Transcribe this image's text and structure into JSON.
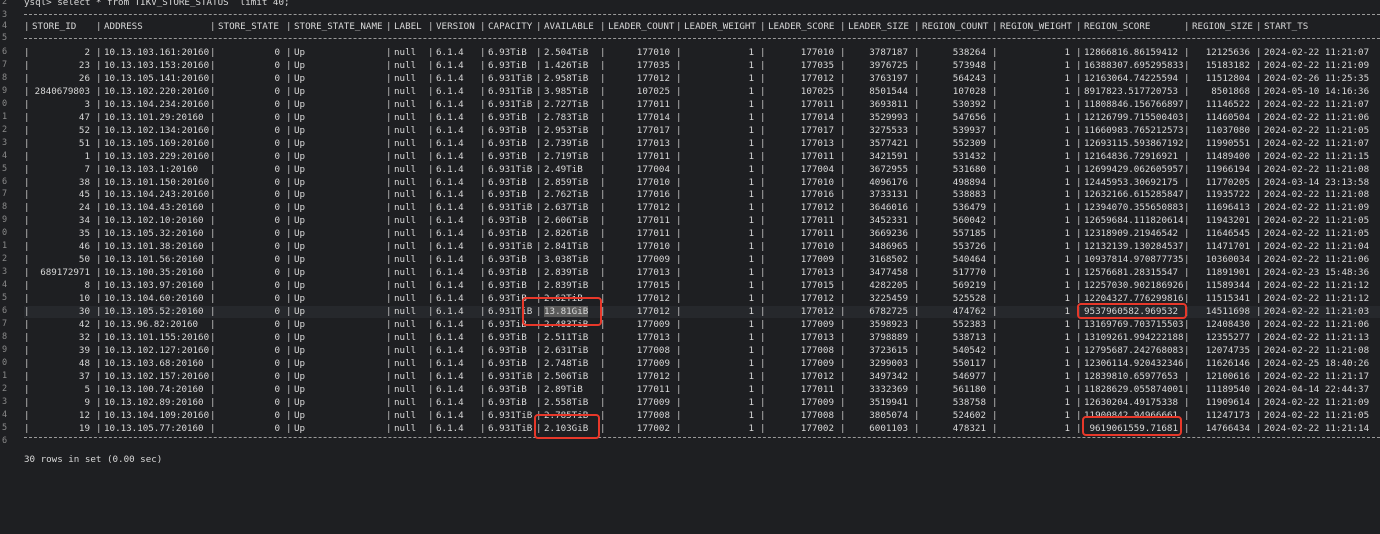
{
  "command": "ysql> select * from TIKV_STORE_STATUS  limit 40;",
  "footer": "30 rows in set (0.00 sec)",
  "gutter": [
    "2",
    "3",
    "4",
    "5",
    "6",
    "7",
    "8",
    "9",
    "0",
    "1",
    "2",
    "3",
    "4",
    "5",
    "6",
    "7",
    "8",
    "9",
    "0",
    "1",
    "2",
    "3",
    "4",
    "5",
    "6",
    "7",
    "8",
    "9",
    "0",
    "1",
    "2",
    "3",
    "4",
    "5",
    "6"
  ],
  "columns": [
    "STORE_ID",
    "ADDRESS",
    "STORE_STATE",
    "STORE_STATE_NAME",
    "LABEL",
    "VERSION",
    "CAPACITY",
    "AVAILABLE",
    "LEADER_COUNT",
    "LEADER_WEIGHT",
    "LEADER_SCORE",
    "LEADER_SIZE",
    "REGION_COUNT",
    "REGION_WEIGHT",
    "REGION_SCORE",
    "REGION_SIZE",
    "START_TS"
  ],
  "rows": [
    [
      "2",
      "10.13.103.161:20160",
      "0",
      "Up",
      "null",
      "6.1.4",
      "6.93TiB",
      "2.504TiB",
      "177010",
      "1",
      "177010",
      "3787187",
      "538264",
      "1",
      "12866816.86159412",
      "12125636",
      "2024-02-22 11:21:07"
    ],
    [
      "23",
      "10.13.103.153:20160",
      "0",
      "Up",
      "null",
      "6.1.4",
      "6.93TiB",
      "1.426TiB",
      "177035",
      "1",
      "177035",
      "3976725",
      "573948",
      "1",
      "16388307.695295833",
      "15183182",
      "2024-02-22 11:21:09"
    ],
    [
      "26",
      "10.13.105.141:20160",
      "0",
      "Up",
      "null",
      "6.1.4",
      "6.931TiB",
      "2.958TiB",
      "177012",
      "1",
      "177012",
      "3763197",
      "564243",
      "1",
      "12163064.74225594",
      "11512804",
      "2024-02-26 11:25:35"
    ],
    [
      "2840679803",
      "10.13.102.220:20160",
      "0",
      "Up",
      "null",
      "6.1.4",
      "6.931TiB",
      "3.985TiB",
      "107025",
      "1",
      "107025",
      "8501544",
      "107028",
      "1",
      "8917823.517720753",
      "8501868",
      "2024-05-10 14:16:36"
    ],
    [
      "3",
      "10.13.104.234:20160",
      "0",
      "Up",
      "null",
      "6.1.4",
      "6.931TiB",
      "2.727TiB",
      "177011",
      "1",
      "177011",
      "3693811",
      "530392",
      "1",
      "11808846.156766897",
      "11146522",
      "2024-02-22 11:21:07"
    ],
    [
      "47",
      "10.13.101.29:20160",
      "0",
      "Up",
      "null",
      "6.1.4",
      "6.93TiB",
      "2.783TiB",
      "177014",
      "1",
      "177014",
      "3529993",
      "547656",
      "1",
      "12126799.715500403",
      "11460504",
      "2024-02-22 11:21:06"
    ],
    [
      "52",
      "10.13.102.134:20160",
      "0",
      "Up",
      "null",
      "6.1.4",
      "6.93TiB",
      "2.953TiB",
      "177017",
      "1",
      "177017",
      "3275533",
      "539937",
      "1",
      "11660983.765212573",
      "11037080",
      "2024-02-22 11:21:05"
    ],
    [
      "51",
      "10.13.105.169:20160",
      "0",
      "Up",
      "null",
      "6.1.4",
      "6.93TiB",
      "2.739TiB",
      "177013",
      "1",
      "177013",
      "3577421",
      "552309",
      "1",
      "12693115.593867192",
      "11990551",
      "2024-02-22 11:21:07"
    ],
    [
      "1",
      "10.13.103.229:20160",
      "0",
      "Up",
      "null",
      "6.1.4",
      "6.93TiB",
      "2.719TiB",
      "177011",
      "1",
      "177011",
      "3421591",
      "531432",
      "1",
      "12164836.72916921",
      "11489400",
      "2024-02-22 11:21:15"
    ],
    [
      "7",
      "10.13.103.1:20160",
      "0",
      "Up",
      "null",
      "6.1.4",
      "6.931TiB",
      "2.49TiB",
      "177004",
      "1",
      "177004",
      "3672955",
      "531680",
      "1",
      "12699429.062605957",
      "11966194",
      "2024-02-22 11:21:08"
    ],
    [
      "38",
      "10.13.101.150:20160",
      "0",
      "Up",
      "null",
      "6.1.4",
      "6.93TiB",
      "2.859TiB",
      "177010",
      "1",
      "177010",
      "4096176",
      "498894",
      "1",
      "12445953.30692175",
      "11770205",
      "2024-03-14 23:13:58"
    ],
    [
      "45",
      "10.13.104.243:20160",
      "0",
      "Up",
      "null",
      "6.1.4",
      "6.93TiB",
      "2.762TiB",
      "177016",
      "1",
      "177016",
      "3733131",
      "538883",
      "1",
      "12632166.615285847",
      "11935722",
      "2024-02-22 11:21:08"
    ],
    [
      "24",
      "10.13.104.43:20160",
      "0",
      "Up",
      "null",
      "6.1.4",
      "6.931TiB",
      "2.637TiB",
      "177012",
      "1",
      "177012",
      "3646016",
      "536479",
      "1",
      "12394070.355650883",
      "11696413",
      "2024-02-22 11:21:09"
    ],
    [
      "34",
      "10.13.102.10:20160",
      "0",
      "Up",
      "null",
      "6.1.4",
      "6.93TiB",
      "2.606TiB",
      "177011",
      "1",
      "177011",
      "3452331",
      "560042",
      "1",
      "12659684.111820614",
      "11943201",
      "2024-02-22 11:21:05"
    ],
    [
      "35",
      "10.13.105.32:20160",
      "0",
      "Up",
      "null",
      "6.1.4",
      "6.93TiB",
      "2.826TiB",
      "177011",
      "1",
      "177011",
      "3669236",
      "557185",
      "1",
      "12318909.21946542",
      "11646545",
      "2024-02-22 11:21:05"
    ],
    [
      "46",
      "10.13.101.38:20160",
      "0",
      "Up",
      "null",
      "6.1.4",
      "6.931TiB",
      "2.841TiB",
      "177010",
      "1",
      "177010",
      "3486965",
      "553726",
      "1",
      "12132139.130284537",
      "11471701",
      "2024-02-22 11:21:04"
    ],
    [
      "50",
      "10.13.101.56:20160",
      "0",
      "Up",
      "null",
      "6.1.4",
      "6.93TiB",
      "3.038TiB",
      "177009",
      "1",
      "177009",
      "3168502",
      "540464",
      "1",
      "10937814.970877735",
      "10360034",
      "2024-02-22 11:21:06"
    ],
    [
      "689172971",
      "10.13.100.35:20160",
      "0",
      "Up",
      "null",
      "6.1.4",
      "6.93TiB",
      "2.839TiB",
      "177013",
      "1",
      "177013",
      "3477458",
      "517770",
      "1",
      "12576681.28315547",
      "11891901",
      "2024-02-23 15:48:36"
    ],
    [
      "8",
      "10.13.103.97:20160",
      "0",
      "Up",
      "null",
      "6.1.4",
      "6.93TiB",
      "2.839TiB",
      "177015",
      "1",
      "177015",
      "4282205",
      "569219",
      "1",
      "12257030.902186926",
      "11589344",
      "2024-02-22 11:21:12"
    ],
    [
      "10",
      "10.13.104.60:20160",
      "0",
      "Up",
      "null",
      "6.1.4",
      "6.93TiB",
      "2.62TiB",
      "177012",
      "1",
      "177012",
      "3225459",
      "525528",
      "1",
      "12204327.776299816",
      "11515341",
      "2024-02-22 11:21:12"
    ],
    [
      "30",
      "10.13.105.52:20160",
      "0",
      "Up",
      "null",
      "6.1.4",
      "6.931TiB",
      "13.81GiB",
      "177012",
      "1",
      "177012",
      "6782725",
      "474762",
      "1",
      "9537960582.969532",
      "14511698",
      "2024-02-22 11:21:03"
    ],
    [
      "42",
      "10.13.96.82:20160",
      "0",
      "Up",
      "null",
      "6.1.4",
      "6.93TiB",
      "2.483TiB",
      "177009",
      "1",
      "177009",
      "3598923",
      "552383",
      "1",
      "13169769.703715503",
      "12408430",
      "2024-02-22 11:21:06"
    ],
    [
      "32",
      "10.13.101.155:20160",
      "0",
      "Up",
      "null",
      "6.1.4",
      "6.93TiB",
      "2.511TiB",
      "177013",
      "1",
      "177013",
      "3798889",
      "538713",
      "1",
      "13109261.994222188",
      "12355277",
      "2024-02-22 11:21:13"
    ],
    [
      "39",
      "10.13.102.127:20160",
      "0",
      "Up",
      "null",
      "6.1.4",
      "6.93TiB",
      "2.631TiB",
      "177008",
      "1",
      "177008",
      "3723615",
      "540542",
      "1",
      "12795687.242768083",
      "12074735",
      "2024-02-22 11:21:08"
    ],
    [
      "48",
      "10.13.103.68:20160",
      "0",
      "Up",
      "null",
      "6.1.4",
      "6.93TiB",
      "2.748TiB",
      "177009",
      "1",
      "177009",
      "3299003",
      "550117",
      "1",
      "12306114.920432346",
      "11626146",
      "2024-02-25 18:40:26"
    ],
    [
      "37",
      "10.13.102.157:20160",
      "0",
      "Up",
      "null",
      "6.1.4",
      "6.931TiB",
      "2.506TiB",
      "177012",
      "1",
      "177012",
      "3497342",
      "546977",
      "1",
      "12839810.65977653",
      "12100616",
      "2024-02-22 11:21:17"
    ],
    [
      "5",
      "10.13.100.74:20160",
      "0",
      "Up",
      "null",
      "6.1.4",
      "6.93TiB",
      "2.89TiB",
      "177011",
      "1",
      "177011",
      "3332369",
      "561180",
      "1",
      "11828629.055874001",
      "11189540",
      "2024-04-14 22:44:37"
    ],
    [
      "9",
      "10.13.102.89:20160",
      "0",
      "Up",
      "null",
      "6.1.4",
      "6.93TiB",
      "2.558TiB",
      "177009",
      "1",
      "177009",
      "3519941",
      "538758",
      "1",
      "12630204.49175338",
      "11909614",
      "2024-02-22 11:21:09"
    ],
    [
      "12",
      "10.13.104.109:20160",
      "0",
      "Up",
      "null",
      "6.1.4",
      "6.931TiB",
      "2.785TiB",
      "177008",
      "1",
      "177008",
      "3805074",
      "524602",
      "1",
      "11900842.94966661",
      "11247173",
      "2024-02-22 11:21:05"
    ],
    [
      "19",
      "10.13.105.77:20160",
      "0",
      "Up",
      "null",
      "6.1.4",
      "6.931TiB",
      "2.103GiB",
      "177002",
      "1",
      "177002",
      "6001103",
      "478321",
      "1",
      "9619061559.71681",
      "14766434",
      "2024-02-22 11:21:14"
    ]
  ],
  "highlight_color": "#e8382a",
  "background_color": "#1e1f22"
}
